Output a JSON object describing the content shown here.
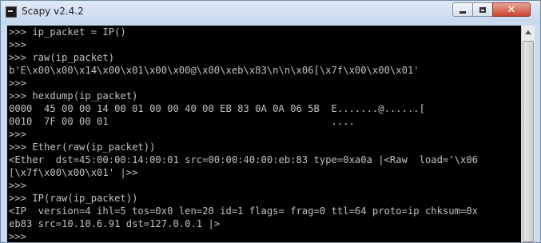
{
  "window": {
    "title": "Scapy v2.4.2",
    "icon": "terminal-icon",
    "controls": {
      "minimize": "minimize-icon",
      "maximize": "maximize-icon",
      "close": "✕"
    }
  },
  "console": {
    "lines": [
      ">>> ip_packet = IP()",
      ">>>",
      ">>> raw(ip_packet)",
      "b'E\\x00\\x00\\x14\\x00\\x01\\x00\\x00@\\x00\\xeb\\x83\\n\\n\\x06[\\x7f\\x00\\x00\\x01'",
      ">>>",
      ">>> hexdump(ip_packet)",
      "0000  45 00 00 14 00 01 00 00 40 00 EB 83 0A 0A 06 5B  E.......@......[",
      "0010  7F 00 00 01                                      ....",
      ">>>",
      ">>> Ether(raw(ip_packet))",
      "<Ether  dst=45:00:00:14:00:01 src=00:00:40:00:eb:83 type=0xa0a |<Raw  load='\\x06",
      "[\\x7f\\x00\\x00\\x01' |>>",
      ">>>",
      ">>> IP(raw(ip_packet))",
      "<IP  version=4 ihl=5 tos=0x0 len=20 id=1 flags= frag=0 ttl=64 proto=ip chksum=0x",
      "eb83 src=10.10.6.91 dst=127.0.0.1 |>",
      ">>>"
    ]
  },
  "colors": {
    "console_bg": "#000000",
    "console_text": "#c0c0c0",
    "titlebar": "#c9dbee",
    "close_button": "#c7452f"
  }
}
